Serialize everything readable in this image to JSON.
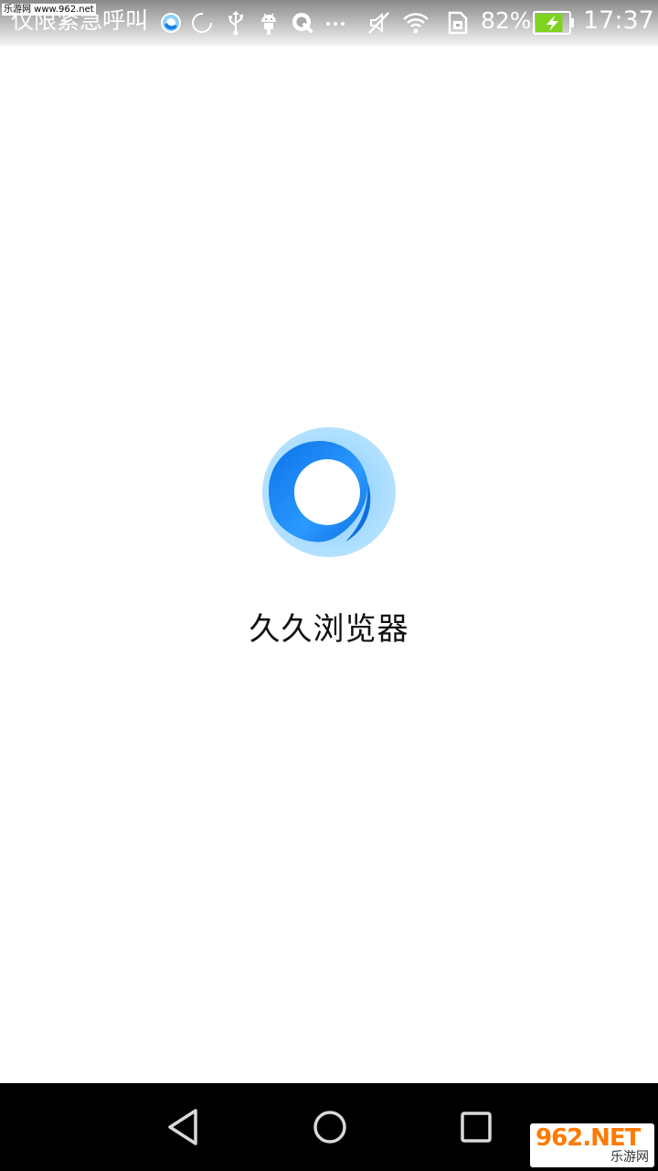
{
  "status_bar": {
    "carrier_text": "仅限紧急呼叫",
    "battery_percent": "82%",
    "time": "17:37",
    "battery_level": 0.82,
    "battery_color": "#7ed321",
    "icons": [
      "browser-icon",
      "loading-icon",
      "usb-icon",
      "android-icon",
      "search-icon",
      "more-icon",
      "mute-icon",
      "wifi-icon",
      "sim-icon",
      "battery-charging-icon"
    ]
  },
  "watermark": {
    "top_text": "乐游网 www.962.net",
    "badge_main": "962.NET",
    "badge_sub": "乐游网"
  },
  "splash": {
    "app_name": "久久浏览器",
    "logo_colors": {
      "outer": "#a9dcff",
      "inner": "#1a8cff"
    }
  },
  "nav_bar": {
    "buttons": [
      "back-icon",
      "home-icon",
      "recent-apps-icon"
    ]
  }
}
